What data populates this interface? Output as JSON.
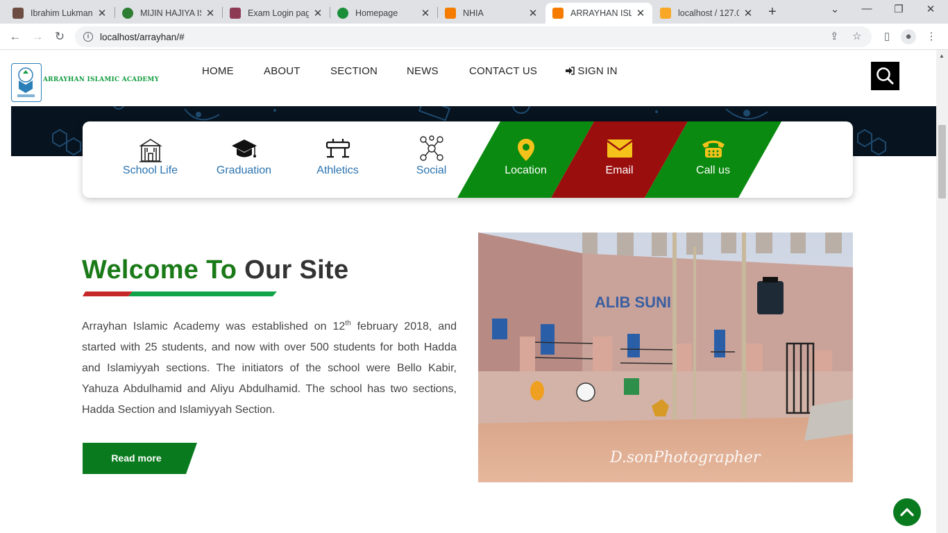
{
  "browser": {
    "tabs": [
      {
        "label": "Ibrahim Lukman",
        "favicon_color": "#6d4c41",
        "active": false
      },
      {
        "label": "MIJIN HAJIYA ISL",
        "favicon_color": "#2e7d32",
        "active": false
      },
      {
        "label": "Exam Login page",
        "favicon_color": "#8d3b55",
        "active": false
      },
      {
        "label": "Homepage",
        "favicon_color": "#1b8e3a",
        "active": false
      },
      {
        "label": "NHIA",
        "favicon_color": "#f57c00",
        "active": false
      },
      {
        "label": "ARRAYHAN ISLA",
        "favicon_color": "#f57c00",
        "active": true
      },
      {
        "label": "localhost / 127.0.",
        "favicon_color": "#f9a825",
        "active": false
      }
    ],
    "url": "localhost/arrayhan/#"
  },
  "site": {
    "logo_name": "ARRAYHAN ISLAMIC ACADEMY",
    "nav": [
      "HOME",
      "ABOUT",
      "SECTION",
      "NEWS",
      "CONTACT US",
      "SIGN IN"
    ],
    "features": [
      {
        "label": "School Life",
        "icon": "school-building-icon"
      },
      {
        "label": "Graduation",
        "icon": "graduation-cap-icon"
      },
      {
        "label": "Athletics",
        "icon": "gym-bench-icon"
      },
      {
        "label": "Social",
        "icon": "social-network-icon"
      },
      {
        "label": "Location",
        "icon": "map-pin-icon",
        "bg": "#0a8a10"
      },
      {
        "label": "Email",
        "icon": "envelope-icon",
        "bg": "#9b0e0e"
      },
      {
        "label": "Call us",
        "icon": "phone-icon",
        "bg": "#0a8a10"
      }
    ],
    "welcome": {
      "title_green": "Welcome To",
      "title_dark": "Our Site",
      "para_part1": "Arrayhan Islamic Academy was established on 12",
      "para_sup": "th",
      "para_part2": " february 2018, and started with 25 students, and now with over 500 students for both Hadda and Islamiyyah sections. The initiators of the school were Bello Kabir, Yahuza Abdulhamid and Aliyu Abdulhamid. The school has two sections, Hadda Section and Islamiyyah Section.",
      "read_more": "Read more"
    },
    "photo": {
      "signature": "D.sonPhotographer",
      "sign_text": "ALIB SUNI"
    },
    "colors": {
      "green": "#0a8a10",
      "red": "#9b0e0e",
      "title_green": "#1b7a18"
    }
  }
}
